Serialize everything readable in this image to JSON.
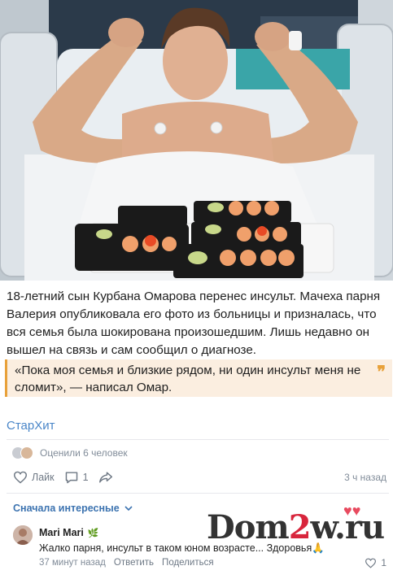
{
  "post": {
    "text": "18-летний сын Курбана Омарова перенес инсульт. Мачеха парня Валерия опубликовала его фото из больницы и призналась, что вся семья была шокирована произошедшим. Лишь недавно он вышел на связь и сам сообщил о диагнозе.",
    "quote": "«Пока моя семья и близкие рядом, ни один инсульт меня не сломит», — написал Омар.",
    "quote_mark": "❞",
    "source": "СтарХит",
    "rated": "Оценили 6 человек",
    "like_label": "Лайк",
    "comments_count": "1",
    "time": "3 ч назад"
  },
  "comments": {
    "sort_label": "Сначала интересные",
    "items": [
      {
        "author": "Mari Mari",
        "text": "Жалко парня, инсульт в таком юном возрасте... Здоровья🙏",
        "time": "37 минут назад",
        "reply_label": "Ответить",
        "share_label": "Поделиться",
        "likes": "1"
      }
    ]
  },
  "watermark": {
    "part1": "Dom",
    "part2": "2",
    "part3": "w.ru"
  },
  "colors": {
    "link": "#4a86c8",
    "quote_bg": "#fbeee0",
    "quote_accent": "#e8a13a",
    "watermark_red": "#d8253c"
  }
}
